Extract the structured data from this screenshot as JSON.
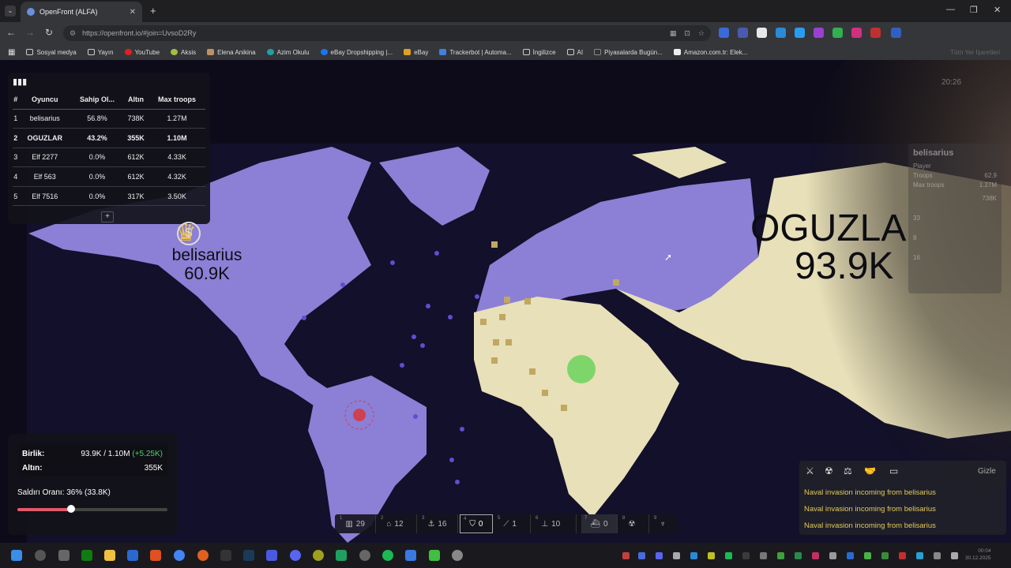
{
  "browser": {
    "tab_title": "OpenFront (ALFA)",
    "url": "https://openfront.io/#join=UvsoD2Ry",
    "bookmarks": [
      "Sosyal medya",
      "Yayın",
      "YouTube",
      "Aksis",
      "Elena Anikina",
      "Azim Okulu",
      "eBay Dropshipping |...",
      "eBay",
      "Trackerbot | Automa...",
      "İngilizce",
      "AI",
      "Piyasalarda Bugün...",
      "Amazon.com.tr: Elek..."
    ],
    "bookmarks_overflow": "Tüm Yer İşaretleri"
  },
  "leaderboard": {
    "headers": [
      "#",
      "Oyuncu",
      "Sahip Ol...",
      "Altın",
      "Max troops"
    ],
    "rows": [
      {
        "rank": "1",
        "player": "belisarius",
        "owned": "56.8%",
        "gold": "738K",
        "troops": "1.27M"
      },
      {
        "rank": "2",
        "player": "OGUZLAR",
        "owned": "43.2%",
        "gold": "355K",
        "troops": "1.10M"
      },
      {
        "rank": "3",
        "player": "Elf 2277",
        "owned": "0.0%",
        "gold": "612K",
        "troops": "4.33K"
      },
      {
        "rank": "4",
        "player": "Elf 563",
        "owned": "0.0%",
        "gold": "612K",
        "troops": "4.32K"
      },
      {
        "rank": "5",
        "player": "Elf 7516",
        "owned": "0.0%",
        "gold": "317K",
        "troops": "3.50K"
      }
    ],
    "expand": "+"
  },
  "map_labels": {
    "p1_name": "belisarius",
    "p1_troops": "60.9K",
    "p2_name": "OGUZLA",
    "p2_troops": "93.9K"
  },
  "player_card": {
    "name": "belisarius",
    "type": "Player",
    "troops_label": "Troops",
    "troops_value": "62.9",
    "maxtroops_label": "Max troops",
    "maxtroops_value": "1.27M",
    "gold_value": "738K",
    "v1": "33",
    "v2": "8",
    "v3": "16"
  },
  "stats": {
    "troops_label": "Birlik:",
    "troops_value": "93.9K / 1.10M",
    "troops_delta": "(+5.25K)",
    "gold_label": "Altın:",
    "gold_value": "355K",
    "attack_label": "Saldırı Oranı: 36% (33.8K)",
    "attack_ratio": 0.36
  },
  "build_bar": [
    {
      "key": "1",
      "value": "29"
    },
    {
      "key": "2",
      "value": "12"
    },
    {
      "key": "3",
      "value": "16"
    },
    {
      "key": "4",
      "value": "0"
    },
    {
      "key": "5",
      "value": "1"
    },
    {
      "key": "6",
      "value": "10"
    },
    {
      "key": "7",
      "value": "0"
    },
    {
      "key": "8",
      "value": ""
    },
    {
      "key": "9",
      "value": ""
    }
  ],
  "events": {
    "hide_label": "Gizle",
    "messages": [
      "Naval invasion incoming from belisarius",
      "Naval invasion incoming from belisarius",
      "Naval invasion incoming from belisarius"
    ]
  },
  "hud_time": "20:26",
  "taskbar": {
    "time": "00:04",
    "date": "30.12.2025"
  },
  "colors": {
    "player1": "#8b7fd6",
    "player2": "#e8e0b8",
    "ocean": "#0d0b1a",
    "event_text": "#e3c95a"
  }
}
